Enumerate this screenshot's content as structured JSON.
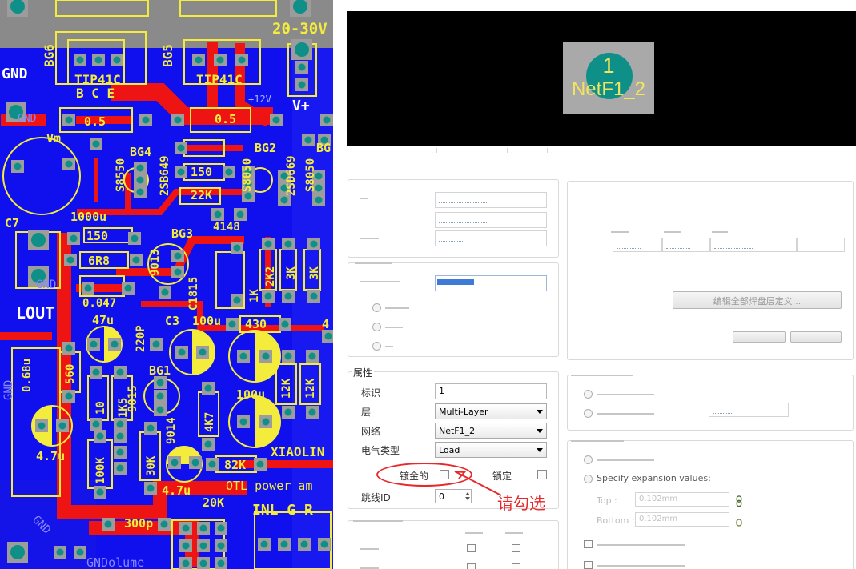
{
  "pcb": {
    "texts": {
      "voltage": "20-30V",
      "gnd_top": "GND",
      "bg6": "BG6",
      "bg5": "BG5",
      "tip_left": "TIP41C",
      "tip_right": "TIP41C",
      "bce": "B C E",
      "v_plus": "V+",
      "plus12v_a": "+12V",
      "plus12v_b": "+12V",
      "plus12v_c": "+12V",
      "gnd_left": "GND",
      "r_05_left": "0.5",
      "r_05_right": "0.5",
      "vm": "Vm",
      "bg4": "BG4",
      "bg2": "BG2",
      "bg_right": "BG",
      "s8550": "S8550",
      "sb649": "2SB649",
      "sd669": "2SD669",
      "s8050": "S8050",
      "s8050_b": "S8050",
      "r150a": "150",
      "r22k": "22K",
      "c1000u": "1000u",
      "c7": "C7",
      "r150": "150",
      "r6r8": "6R8",
      "d4148": "4148",
      "bg3": "BG3",
      "s9013": "9013",
      "c1815": "C1815",
      "r2k2": "2K2",
      "r3k_a": "3K",
      "r3k_b": "3K",
      "gnd_mid": "GND",
      "lout": "LOUT",
      "c047": "0.047",
      "c47u": "47u",
      "c220p": "220P",
      "c3": "C3",
      "c100u": "100u",
      "r430": "430",
      "d1k": "1K",
      "c068u": "0.68u",
      "r560": "560",
      "gnd_side": "GND",
      "bg1": "BG1",
      "s9015": "9015",
      "s9014": "9014",
      "r10": "10",
      "r1k5": "1K5",
      "r4k7": "4K7",
      "c100u_b": "100u",
      "r12k": "12K",
      "r12k_b": "12K",
      "c47u_b": "4.7u",
      "r100k": "100K",
      "r30k": "30K",
      "c47u_c": "4.7u",
      "r82k": "82K",
      "xiaolin": "XIAOLIN",
      "otl": "OTL power am",
      "r20k": "20K",
      "c300p": "300p",
      "inlgr": "INL G R",
      "gnd_bottom": "GND",
      "volume": "GNDolume",
      "r1k4": "4"
    }
  },
  "dialog": {
    "preview": {
      "pad_number": "1",
      "pad_net": "NetF1_2"
    },
    "blurred_button": "编辑全部焊盘层定义...",
    "properties": {
      "legend": "属性",
      "designator_label": "标识",
      "designator_value": "1",
      "layer_label": "层",
      "layer_value": "Multi-Layer",
      "net_label": "网络",
      "net_value": "NetF1_2",
      "electrical_type_label": "电气类型",
      "electrical_type_value": "Load",
      "plated_label": "镀金的",
      "locked_label": "锁定",
      "jumper_id_label": "跳线ID",
      "jumper_id_value": "0"
    },
    "annotation": {
      "text": "请勾选",
      "color": "#e8292b"
    },
    "faint": {
      "specify": "Specify expansion values:",
      "top": "Top :",
      "bottom": "Bottom :",
      "top_value": "0.102mm",
      "bottom_value": "0.102mm"
    }
  }
}
